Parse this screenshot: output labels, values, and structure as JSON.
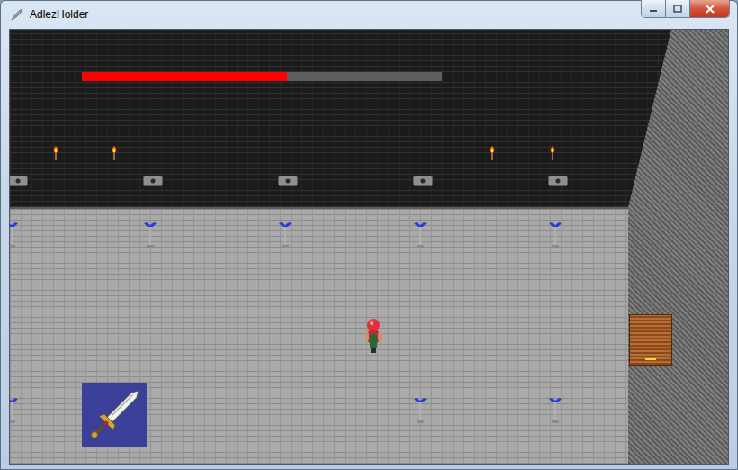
{
  "window": {
    "title": "AdlezHolder"
  },
  "health_bar": {
    "level": 0.57
  }
}
